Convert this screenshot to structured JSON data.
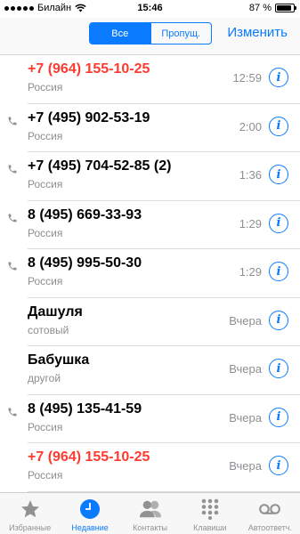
{
  "status_bar": {
    "carrier": "Билайн",
    "time": "15:46",
    "battery": "87 %",
    "battery_level": 0.87
  },
  "nav": {
    "segments": [
      "Все",
      "Пропущ."
    ],
    "active_segment": 0,
    "edit_label": "Изменить"
  },
  "calls": [
    {
      "name": "+7 (964) 155-10-25",
      "sub": "Россия",
      "time": "12:59",
      "missed": true,
      "outgoing": false
    },
    {
      "name": "+7 (495) 902-53-19",
      "sub": "Россия",
      "time": "2:00",
      "missed": false,
      "outgoing": true
    },
    {
      "name": "+7 (495) 704-52-85 (2)",
      "sub": "Россия",
      "time": "1:36",
      "missed": false,
      "outgoing": true
    },
    {
      "name": "8 (495) 669-33-93",
      "sub": "Россия",
      "time": "1:29",
      "missed": false,
      "outgoing": true
    },
    {
      "name": "8 (495) 995-50-30",
      "sub": "Россия",
      "time": "1:29",
      "missed": false,
      "outgoing": true
    },
    {
      "name": "Дашуля",
      "sub": "сотовый",
      "time": "Вчера",
      "missed": false,
      "outgoing": false
    },
    {
      "name": "Бабушка",
      "sub": "другой",
      "time": "Вчера",
      "missed": false,
      "outgoing": false
    },
    {
      "name": "8 (495) 135-41-59",
      "sub": "Россия",
      "time": "Вчера",
      "missed": false,
      "outgoing": true
    },
    {
      "name": "+7 (964) 155-10-25",
      "sub": "Россия",
      "time": "Вчера",
      "missed": true,
      "outgoing": false
    }
  ],
  "tabs": [
    {
      "label": "Избранные",
      "icon": "star-icon",
      "active": false
    },
    {
      "label": "Недавние",
      "icon": "clock-icon",
      "active": true
    },
    {
      "label": "Контакты",
      "icon": "contacts-icon",
      "active": false
    },
    {
      "label": "Клавиши",
      "icon": "keypad-icon",
      "active": false
    },
    {
      "label": "Автоответч.",
      "icon": "voicemail-icon",
      "active": false
    }
  ],
  "colors": {
    "accent": "#0a7aff",
    "missed": "#ff3b30",
    "secondary": "#8e8e93"
  }
}
